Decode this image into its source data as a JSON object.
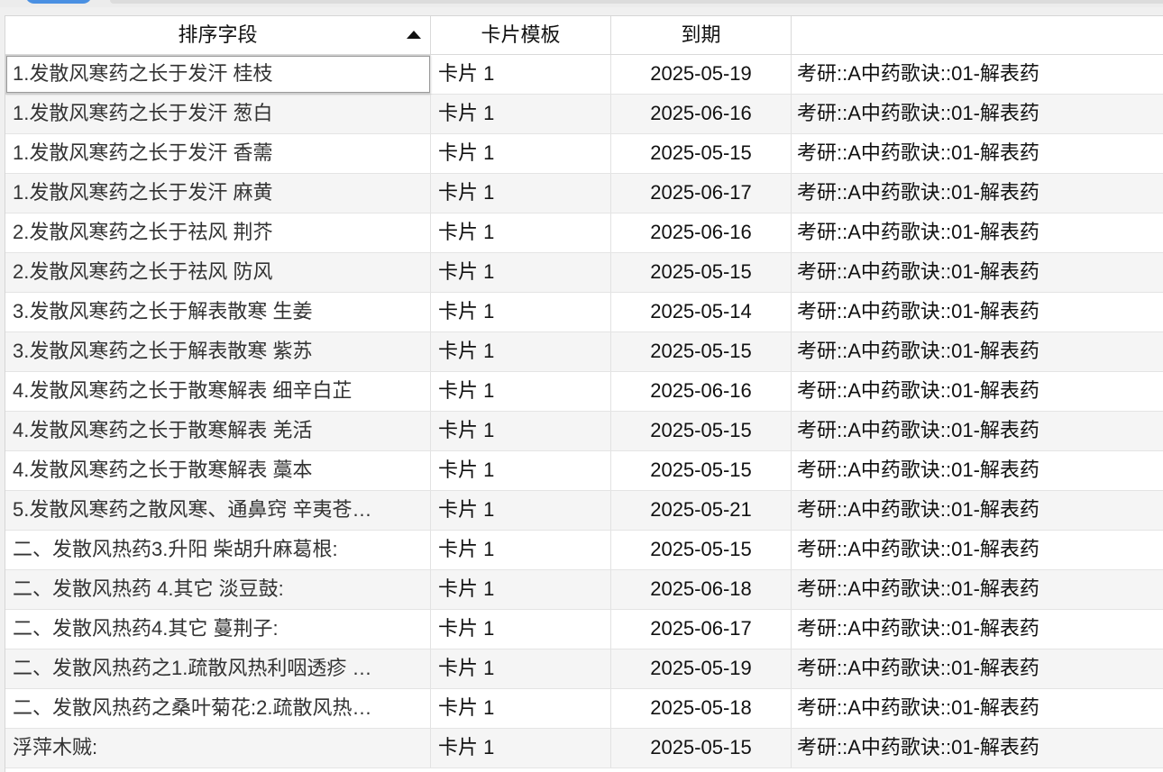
{
  "table": {
    "columns": [
      "排序字段",
      "卡片模板",
      "到期",
      ""
    ],
    "sort_indicator": "ascending",
    "rows": [
      {
        "sort_field": "1.发散风寒药之长于发汗 桂枝",
        "template": "卡片 1",
        "due": "2025-05-19",
        "deck": "考研::A中药歌诀::01-解表药"
      },
      {
        "sort_field": "1.发散风寒药之长于发汗 葱白",
        "template": "卡片 1",
        "due": "2025-06-16",
        "deck": "考研::A中药歌诀::01-解表药"
      },
      {
        "sort_field": "1.发散风寒药之长于发汗 香薷",
        "template": "卡片 1",
        "due": "2025-05-15",
        "deck": "考研::A中药歌诀::01-解表药"
      },
      {
        "sort_field": "1.发散风寒药之长于发汗 麻黄",
        "template": "卡片 1",
        "due": "2025-06-17",
        "deck": "考研::A中药歌诀::01-解表药"
      },
      {
        "sort_field": "2.发散风寒药之长于祛风 荆芥",
        "template": "卡片 1",
        "due": "2025-06-16",
        "deck": "考研::A中药歌诀::01-解表药"
      },
      {
        "sort_field": "2.发散风寒药之长于祛风 防风",
        "template": "卡片 1",
        "due": "2025-05-15",
        "deck": "考研::A中药歌诀::01-解表药"
      },
      {
        "sort_field": "3.发散风寒药之长于解表散寒 生姜",
        "template": "卡片 1",
        "due": "2025-05-14",
        "deck": "考研::A中药歌诀::01-解表药"
      },
      {
        "sort_field": "3.发散风寒药之长于解表散寒 紫苏",
        "template": "卡片 1",
        "due": "2025-05-15",
        "deck": "考研::A中药歌诀::01-解表药"
      },
      {
        "sort_field": "4.发散风寒药之长于散寒解表 细辛白芷",
        "template": "卡片 1",
        "due": "2025-06-16",
        "deck": "考研::A中药歌诀::01-解表药"
      },
      {
        "sort_field": "4.发散风寒药之长于散寒解表 羌活",
        "template": "卡片 1",
        "due": "2025-05-15",
        "deck": "考研::A中药歌诀::01-解表药"
      },
      {
        "sort_field": "4.发散风寒药之长于散寒解表 藁本",
        "template": "卡片 1",
        "due": "2025-05-15",
        "deck": "考研::A中药歌诀::01-解表药"
      },
      {
        "sort_field": "5.发散风寒药之散风寒、通鼻窍 辛夷苍…",
        "template": "卡片 1",
        "due": "2025-05-21",
        "deck": "考研::A中药歌诀::01-解表药"
      },
      {
        "sort_field": "二、发散风热药3.升阳 柴胡升麻葛根:",
        "template": "卡片 1",
        "due": "2025-05-15",
        "deck": "考研::A中药歌诀::01-解表药"
      },
      {
        "sort_field": "二、发散风热药 4.其它 淡豆鼓:",
        "template": "卡片 1",
        "due": "2025-06-18",
        "deck": "考研::A中药歌诀::01-解表药"
      },
      {
        "sort_field": "二、发散风热药4.其它 蔓荆子:",
        "template": "卡片 1",
        "due": "2025-06-17",
        "deck": "考研::A中药歌诀::01-解表药"
      },
      {
        "sort_field": "二、发散风热药之1.疏散风热利咽透疹 …",
        "template": "卡片 1",
        "due": "2025-05-19",
        "deck": "考研::A中药歌诀::01-解表药"
      },
      {
        "sort_field": "二、发散风热药之桑叶菊花:2.疏散风热…",
        "template": "卡片 1",
        "due": "2025-05-18",
        "deck": "考研::A中药歌诀::01-解表药"
      },
      {
        "sort_field": "浮萍木贼:",
        "template": "卡片 1",
        "due": "2025-05-15",
        "deck": "考研::A中药歌诀::01-解表药"
      }
    ]
  }
}
